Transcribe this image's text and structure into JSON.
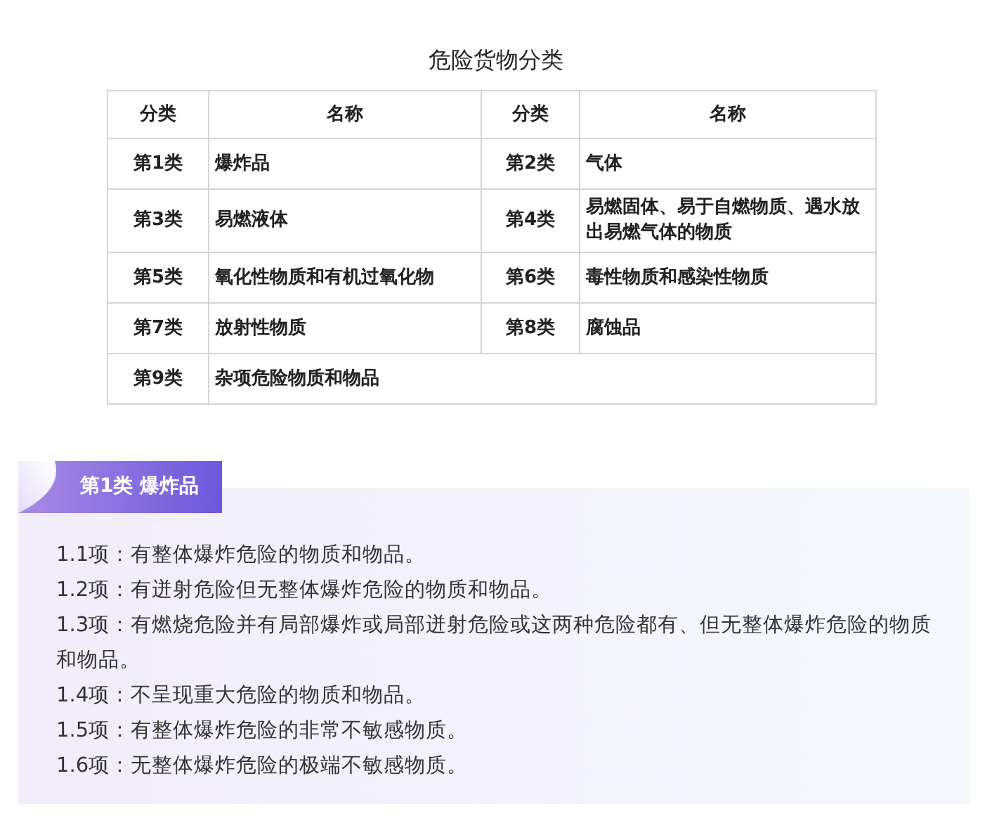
{
  "title": "危险货物分类",
  "columns": [
    "分类",
    "名称",
    "分类",
    "名称"
  ],
  "rows": [
    [
      {
        "class": "第1类",
        "name": "爆炸品"
      },
      {
        "class": "第2类",
        "name": "气体"
      }
    ],
    [
      {
        "class": "第3类",
        "name": "易燃液体"
      },
      {
        "class": "第4类",
        "name": "易燃固体、易于自燃物质、遇水放出易燃气体的物质"
      }
    ],
    [
      {
        "class": "第5类",
        "name": "氧化性物质和有机过氧化物"
      },
      {
        "class": "第6类",
        "name": "毒性物质和感染性物质"
      }
    ],
    [
      {
        "class": "第7类",
        "name": "放射性物质"
      },
      {
        "class": "第8类",
        "name": "腐蚀品"
      }
    ],
    [
      {
        "class": "第9类",
        "name": "杂项危险物质和物品"
      }
    ]
  ],
  "section": {
    "heading": "第1类 爆炸品",
    "items": [
      "1.1项：有整体爆炸危险的物质和物品。",
      "1.2项：有迸射危险但无整体爆炸危险的物质和物品。",
      "1.3项：有燃烧危险并有局部爆炸或局部迸射危险或这两种危险都有、但无整体爆炸危险的物质和物品。",
      "1.4项：不呈现重大危险的物质和物品。",
      "1.5项：有整体爆炸危险的非常不敏感物质。",
      "1.6项：无整体爆炸危险的极端不敏感物质。"
    ]
  }
}
